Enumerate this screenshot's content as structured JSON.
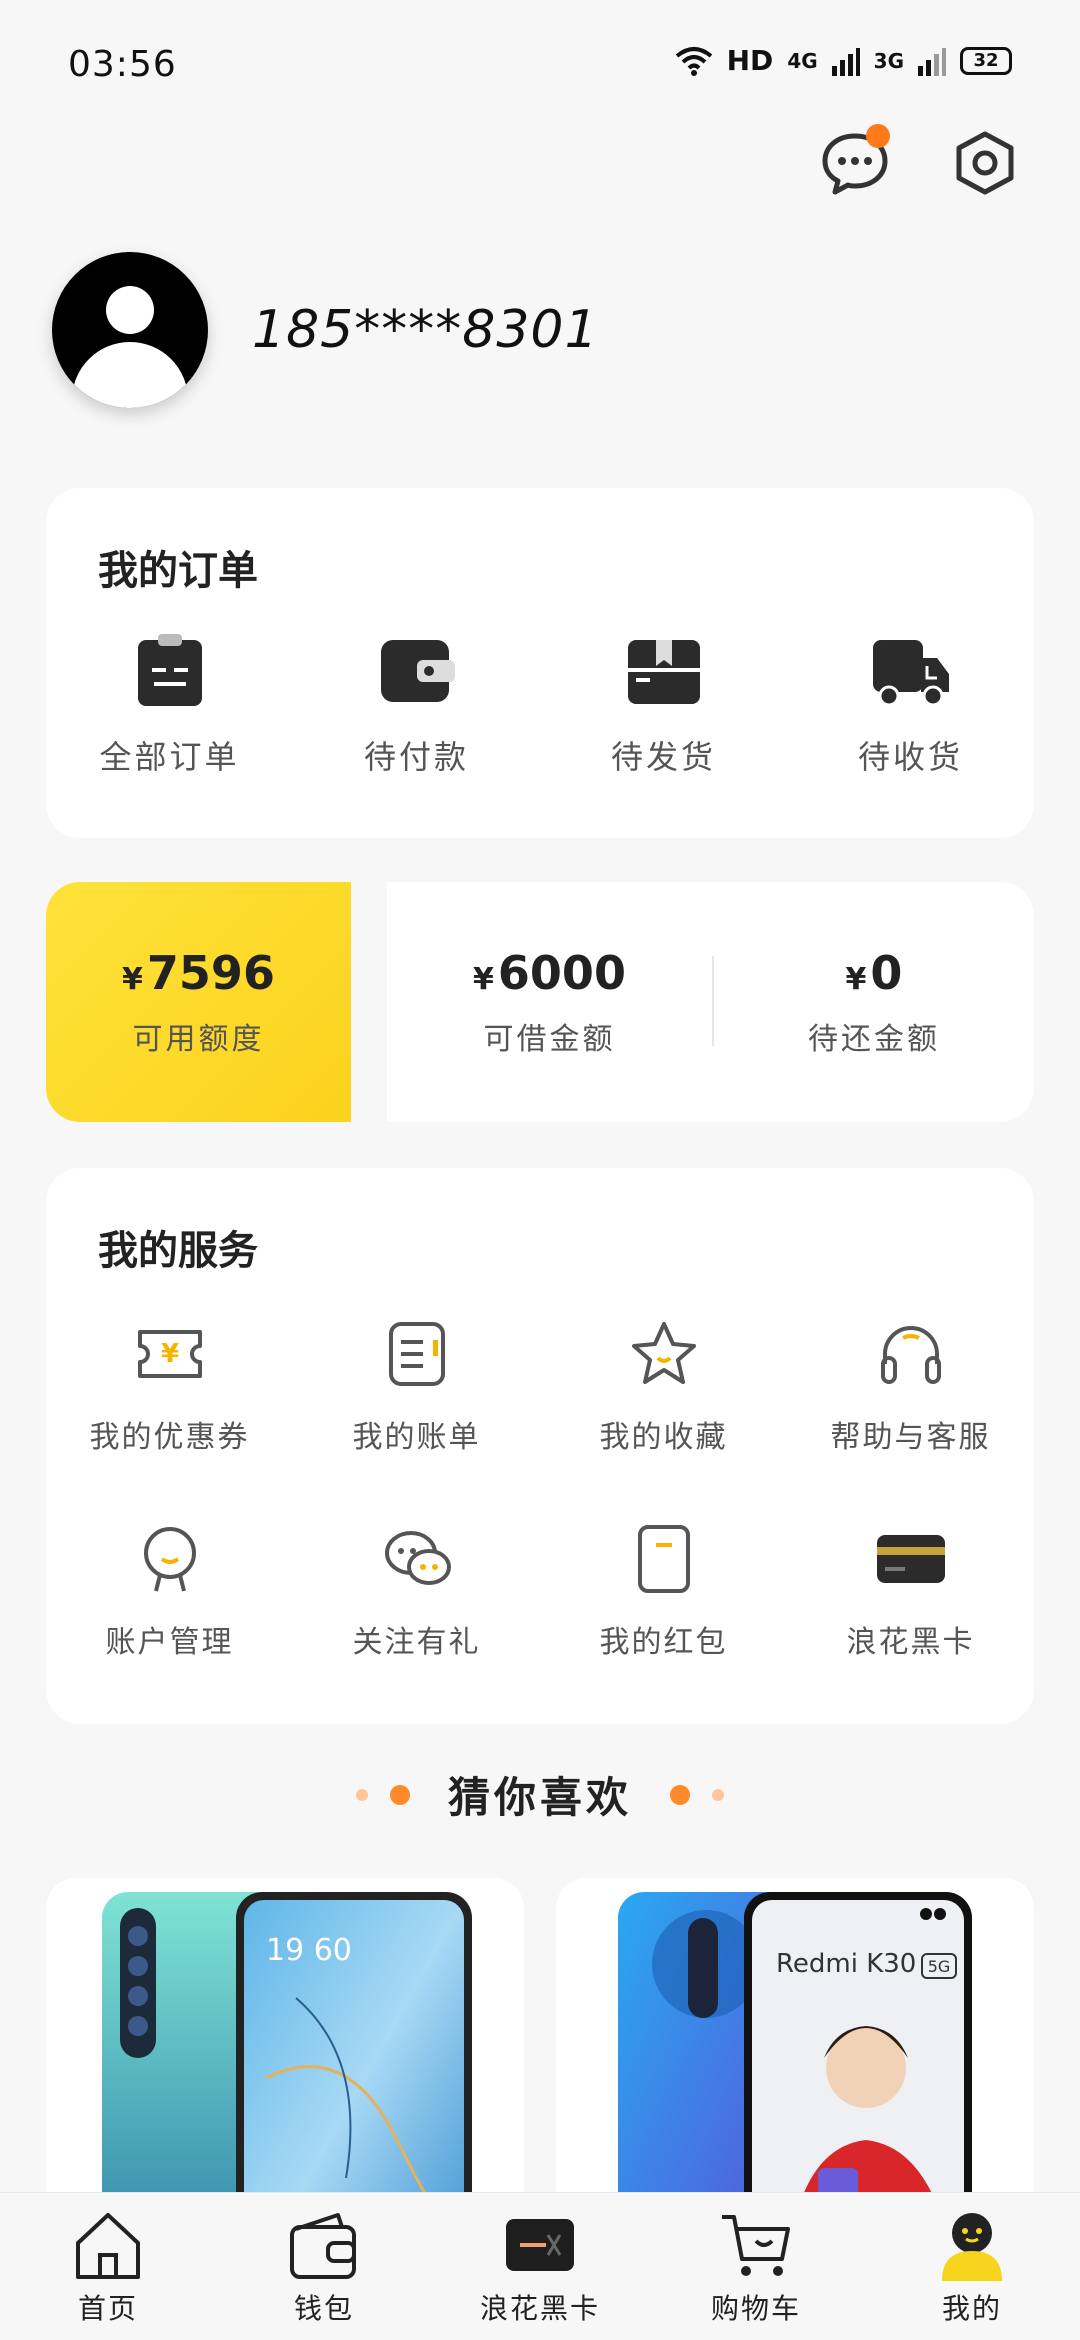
{
  "status": {
    "time": "03:56",
    "network": "HD",
    "sig1": "4G",
    "sig2": "3G",
    "battery": "32"
  },
  "profile": {
    "phone": "185****8301"
  },
  "orders": {
    "title": "我的订单",
    "items": [
      {
        "label": "全部订单",
        "icon": "clipboard-icon"
      },
      {
        "label": "待付款",
        "icon": "wallet-icon"
      },
      {
        "label": "待发货",
        "icon": "package-icon"
      },
      {
        "label": "待收货",
        "icon": "truck-icon"
      }
    ]
  },
  "credit": {
    "available": {
      "currency": "¥",
      "amount": "7596",
      "label": "可用额度"
    },
    "borrowable": {
      "currency": "¥",
      "amount": "6000",
      "label": "可借金额"
    },
    "repay": {
      "currency": "¥",
      "amount": "0",
      "label": "待还金额"
    }
  },
  "services": {
    "title": "我的服务",
    "items": [
      {
        "label": "我的优惠券",
        "icon": "coupon-icon"
      },
      {
        "label": "我的账单",
        "icon": "bill-icon"
      },
      {
        "label": "我的收藏",
        "icon": "star-icon"
      },
      {
        "label": "帮助与客服",
        "icon": "headphones-icon"
      },
      {
        "label": "账户管理",
        "icon": "account-icon"
      },
      {
        "label": "关注有礼",
        "icon": "chat-bubbles-icon"
      },
      {
        "label": "我的红包",
        "icon": "red-packet-icon"
      },
      {
        "label": "浪花黑卡",
        "icon": "black-card-icon"
      }
    ]
  },
  "guess": {
    "title": "猜你喜欢"
  },
  "products": [
    {
      "name": "phone-oppo-reno3",
      "screen_time": "19 60"
    },
    {
      "name": "phone-redmi-k30",
      "brand_text": "Redmi K30",
      "badge": "5G"
    }
  ],
  "tabbar": {
    "items": [
      {
        "label": "首页",
        "icon": "home-icon"
      },
      {
        "label": "钱包",
        "icon": "wallet-icon"
      },
      {
        "label": "浪花黑卡",
        "icon": "black-card-icon"
      },
      {
        "label": "购物车",
        "icon": "cart-icon"
      },
      {
        "label": "我的",
        "icon": "profile-icon"
      }
    ]
  },
  "colors": {
    "accent_yellow": "#fbd21d",
    "accent_orange": "#ff7a1a",
    "icon_dark": "#2b2b2b"
  }
}
